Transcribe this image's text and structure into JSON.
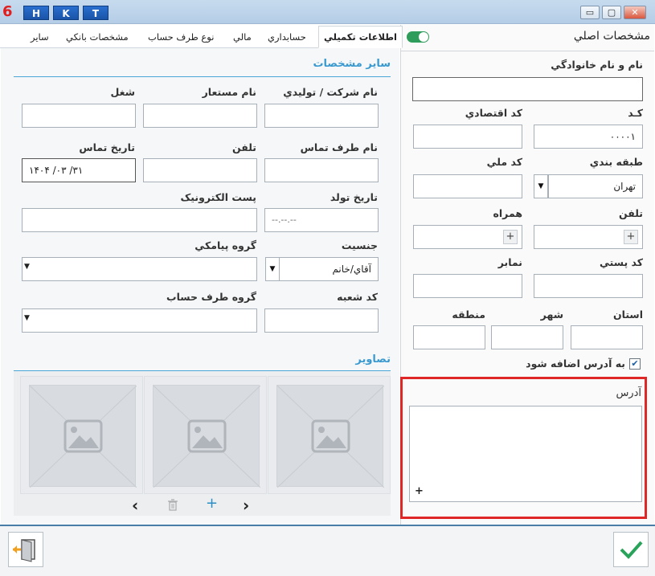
{
  "titlebar": {
    "logo": "6",
    "buttons": [
      "H",
      "K",
      "T"
    ],
    "window_controls": {
      "minimize": "▭",
      "maximize": "▢",
      "close": "✕"
    }
  },
  "tabs": [
    {
      "label": "اطلاعات تکميلي",
      "active": true
    },
    {
      "label": "حسابداري",
      "active": false
    },
    {
      "label": "مالي",
      "active": false
    },
    {
      "label": "نوع طرف حساب",
      "active": false
    },
    {
      "label": "مشخصات بانکي",
      "active": false
    },
    {
      "label": "ساير",
      "active": false
    }
  ],
  "left": {
    "section_other": "ساير مشخصات",
    "company_label": "نام شرکت / توليدي",
    "alias_label": "نام مستعار",
    "job_label": "شغل",
    "contact_name_label": "نام طرف تماس",
    "phone_label": "تلفن",
    "contact_date_label": "تاريخ تماس",
    "contact_date_value": "۱۴۰۴   /۰۳   /۳۱",
    "birth_date_label": "تاريخ تولد",
    "birth_date_value": "--.--.--",
    "email_label": "پست الکترونيک",
    "gender_label": "جنسيت",
    "gender_value": "آقاي/خانم",
    "sms_group_label": "گروه پيامکي",
    "branch_code_label": "کد شعبه",
    "account_group_label": "گروه طرف حساب",
    "section_images": "تصاوير",
    "image_nav": {
      "prev": "‹",
      "delete": "🗑",
      "add": "+",
      "next": "›"
    }
  },
  "right": {
    "title": "مشخصات اصلي",
    "full_name_label": "نام و نام خانوادگي",
    "code_label": "کـد",
    "code_value": "۰۰۰۰۱",
    "economic_code_label": "کد اقتصادي",
    "category_label": "طبقه بندي",
    "category_value": "تهران",
    "national_code_label": "کد ملي",
    "phone_label": "تلفن",
    "mobile_label": "همراه",
    "postal_code_label": "کد پستي",
    "fax_label": "نمابر",
    "province_label": "استان",
    "city_label": "شهر",
    "region_label": "منطقه",
    "add_to_address_label": "به آدرس اضافه شود",
    "address_label": "آدرس"
  },
  "colors": {
    "accent": "#3a9ad0",
    "highlight_border": "#e02727",
    "toggle_on": "#2e9c5a",
    "confirm": "#2aa35a",
    "exit_arrow": "#f0a020"
  }
}
